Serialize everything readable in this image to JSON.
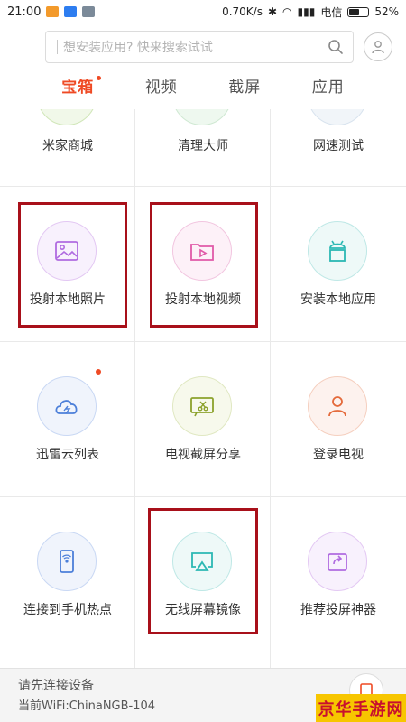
{
  "status_bar": {
    "time": "21:00",
    "speed": "0.70K/s",
    "carrier": "电信",
    "battery": "52%"
  },
  "search": {
    "placeholder": "想安装应用? 快来搜索试试"
  },
  "tabs": [
    {
      "label": "宝箱",
      "active": true,
      "has_dot": true
    },
    {
      "label": "视频",
      "active": false
    },
    {
      "label": "截屏",
      "active": false
    },
    {
      "label": "应用",
      "active": false
    }
  ],
  "grid": {
    "row0": [
      "米家商城",
      "清理大师",
      "网速测试"
    ],
    "row1": [
      "投射本地照片",
      "投射本地视频",
      "安装本地应用"
    ],
    "row2": [
      "迅雷云列表",
      "电视截屏分享",
      "登录电视"
    ],
    "row3": [
      "连接到手机热点",
      "无线屏幕镜像",
      "推荐投屏神器"
    ]
  },
  "icons": {
    "row1": [
      "photo-icon",
      "video-folder-icon",
      "android-icon"
    ],
    "row2": [
      "cloud-icon",
      "tv-screenshot-icon",
      "person-icon"
    ],
    "row3": [
      "phone-hotspot-icon",
      "airplay-icon",
      "share-icon"
    ]
  },
  "colors": {
    "accent": "#ef4a24",
    "highlight_border": "#a8101a",
    "purple": "#b06be0",
    "pink": "#e05aa8",
    "teal": "#2bb8b3",
    "blue": "#4c7fd9",
    "olive": "#8ca22c",
    "orange": "#e46a3b"
  },
  "footer": {
    "title": "请先连接设备",
    "subtitle": "当前WiFi:ChinaNGB-104"
  },
  "watermark": "京华手游网"
}
